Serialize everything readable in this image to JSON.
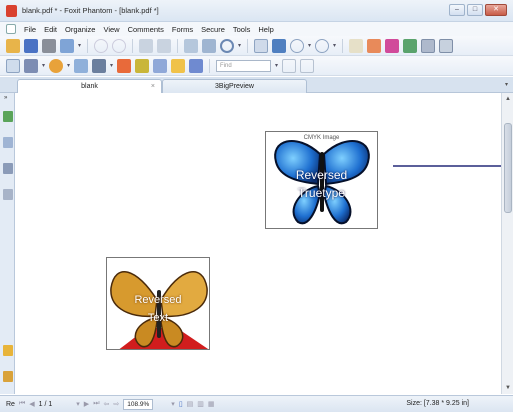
{
  "window": {
    "title": "blank.pdf * - Foxit Phantom - [blank.pdf *]",
    "buttons": [
      "–",
      "□",
      "✕"
    ]
  },
  "menubar": {
    "items": [
      "File",
      "Edit",
      "Organize",
      "View",
      "Comments",
      "Forms",
      "Secure",
      "Tools",
      "Help"
    ]
  },
  "toolbar": {
    "find_placeholder": "Find"
  },
  "tabs": [
    {
      "label": "blank",
      "close": "×"
    },
    {
      "label": "3BigPreview"
    }
  ],
  "document": {
    "image1": {
      "caption": "CMYK Image",
      "line1": "Reversed",
      "line2": "Truetype"
    },
    "image2": {
      "line1": "Reversed",
      "line2": "Text"
    }
  },
  "statusbar": {
    "page": "1 / 1",
    "zoom": "108.9%",
    "size": "Size: [7.38 * 9.25 in]",
    "left_label": "Re"
  },
  "colors": {
    "accent_blue": "#1e6fd0",
    "line": "#5b5f9a"
  }
}
